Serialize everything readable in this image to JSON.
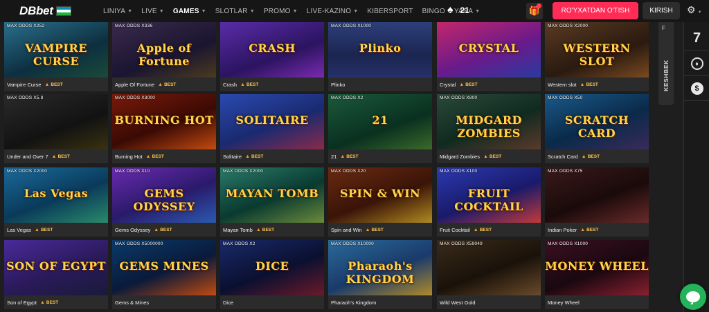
{
  "header": {
    "logo": "DBbet",
    "flag_colors": [
      "#0099b5",
      "#ffffff",
      "#1eb53a"
    ],
    "nav": [
      {
        "label": "LINIYA",
        "dropdown": true,
        "active": false
      },
      {
        "label": "LIVE",
        "dropdown": true,
        "active": false
      },
      {
        "label": "GAMES",
        "dropdown": true,
        "active": true
      },
      {
        "label": "SLOTLAR",
        "dropdown": true,
        "active": false
      },
      {
        "label": "PROMO",
        "dropdown": true,
        "active": false
      },
      {
        "label": "LIVE-KAZINO",
        "dropdown": true,
        "active": false
      },
      {
        "label": "KIBERSPORT",
        "dropdown": false,
        "active": false
      },
      {
        "label": "BINGO",
        "dropdown": false,
        "active": false
      },
      {
        "label": "YANA",
        "dropdown": true,
        "active": false
      }
    ],
    "club_icon": "spade-icon",
    "club_count": "21",
    "register_label": "RO'YXATDAN O'TISH",
    "login_label": "KIRISH",
    "accent_color": "#ff2c56"
  },
  "games": [
    {
      "name": "Vampire Curse",
      "odds": "MAX ODDS X252",
      "best": true,
      "art": "VAMPIRE CURSE"
    },
    {
      "name": "Apple Of Fortune",
      "odds": "MAX ODDS X336",
      "best": true,
      "art": "Apple of Fortune"
    },
    {
      "name": "Crash",
      "odds": "",
      "best": true,
      "art": "CRASH"
    },
    {
      "name": "Plinko",
      "odds": "MAX ODDS X1000",
      "best": false,
      "art": "Plinko"
    },
    {
      "name": "Crystal",
      "odds": "",
      "best": true,
      "art": "CRYSTAL"
    },
    {
      "name": "Western slot",
      "odds": "MAX ODDS X2000",
      "best": true,
      "art": "WESTERN SLOT"
    },
    {
      "name": "Under and Over 7",
      "odds": "MAX ODDS X5.8",
      "best": true,
      "art": ""
    },
    {
      "name": "Burning Hot",
      "odds": "MAX ODDS X3000",
      "best": true,
      "art": "BURNING HOT"
    },
    {
      "name": "Solitaire",
      "odds": "",
      "best": true,
      "art": "SOLITAIRE"
    },
    {
      "name": "21",
      "odds": "MAX ODDS X2",
      "best": true,
      "art": "21"
    },
    {
      "name": "Midgard Zombies",
      "odds": "MAX ODDS X800",
      "best": true,
      "art": "MIDGARD ZOMBIES"
    },
    {
      "name": "Scratch Card",
      "odds": "MAX ODDS X50",
      "best": true,
      "art": "SCRATCH CARD"
    },
    {
      "name": "Las Vegas",
      "odds": "MAX ODDS X2000",
      "best": true,
      "art": "Las Vegas"
    },
    {
      "name": "Gems Odyssey",
      "odds": "MAX ODDS X10",
      "best": true,
      "art": "GEMS ODYSSEY"
    },
    {
      "name": "Mayan Tomb",
      "odds": "MAX ODDS X2000",
      "best": true,
      "art": "MAYAN TOMB"
    },
    {
      "name": "Spin and Win",
      "odds": "MAX ODDS X20",
      "best": true,
      "art": "SPIN & WIN"
    },
    {
      "name": "Fruit Cocktail",
      "odds": "MAX ODDS X100",
      "best": true,
      "art": "FRUIT COCKTAIL"
    },
    {
      "name": "Indian Poker",
      "odds": "MAX ODDS X75",
      "best": true,
      "art": ""
    },
    {
      "name": "Son of Egypt",
      "odds": "",
      "best": true,
      "art": "SON OF EGYPT"
    },
    {
      "name": "Gems & Mines",
      "odds": "MAX ODDS X5000000",
      "best": false,
      "art": "GEMS MINES"
    },
    {
      "name": "Dice",
      "odds": "MAX ODDS X2",
      "best": false,
      "art": "DICE"
    },
    {
      "name": "Pharaoh's Kingdom",
      "odds": "MAX ODDS X10000",
      "best": false,
      "art": "Pharaoh's KINGDOM"
    },
    {
      "name": "Wild West Gold",
      "odds": "MAX ODDS X59049",
      "best": false,
      "art": ""
    },
    {
      "name": "Money Wheel",
      "odds": "MAX ODDS X1000",
      "best": false,
      "art": "MONEY WHEEL"
    }
  ],
  "best_label": "BEST",
  "side": {
    "keshbek_label": "KESHBEK",
    "keshbek_letter": "F",
    "panel_items": [
      "7",
      "chip-icon",
      "$"
    ]
  }
}
